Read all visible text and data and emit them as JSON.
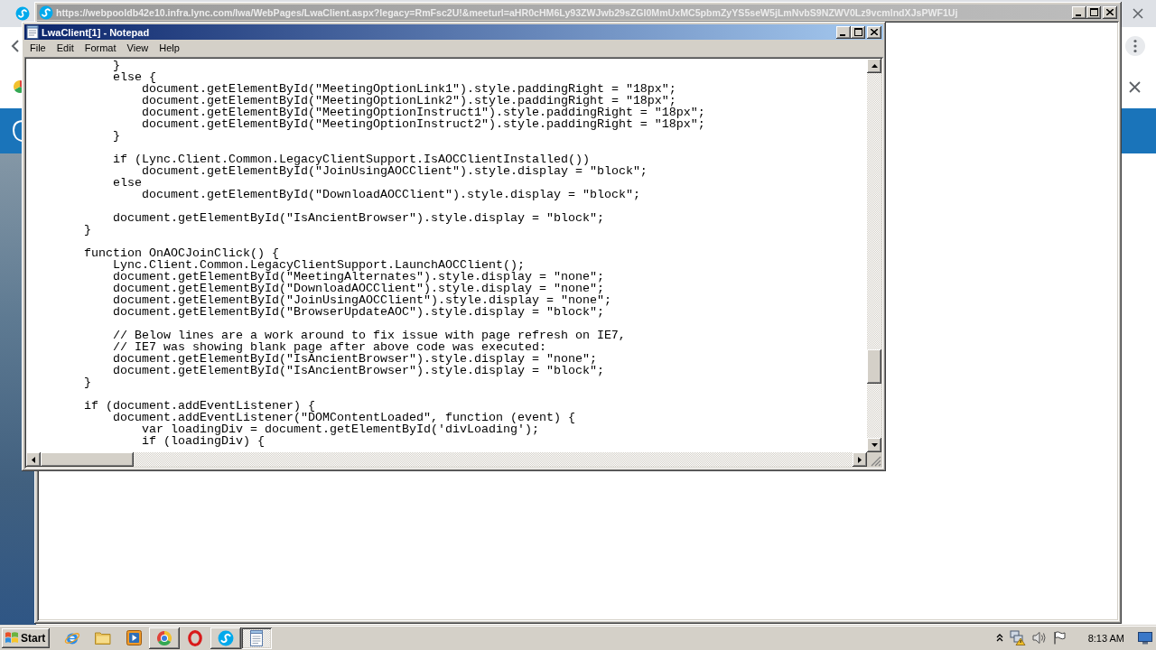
{
  "popup_window": {
    "active": false,
    "title": "https://webpooldb42e10.infra.lync.com/lwa/WebPages/LwaClient.aspx?legacy=RmFsc2U!&meeturl=aHR0cHM6Ly93ZWJwb29sZGI0MmUxMC5pbmZyYS5seW5jLmNvbS9NZWV0Lz9vcmlndXJsPWF1Uj"
  },
  "notepad": {
    "active": true,
    "title": "LwaClient[1] - Notepad",
    "menu": [
      {
        "label": "File"
      },
      {
        "label": "Edit"
      },
      {
        "label": "Format"
      },
      {
        "label": "View"
      },
      {
        "label": "Help"
      }
    ],
    "code": [
      {
        "children": [
          {
            "text": "}"
          },
          {
            "text": "else {",
            "children": [
              {
                "text": "document.getElementById(\"MeetingOptionLink1\").style.paddingRight = \"18px\";"
              },
              {
                "text": "document.getElementById(\"MeetingOptionLink2\").style.paddingRight = \"18px\";"
              },
              {
                "text": "document.getElementById(\"MeetingOptionInstruct1\").style.paddingRight = \"18px\";"
              },
              {
                "text": "document.getElementById(\"MeetingOptionInstruct2\").style.paddingRight = \"18px\";"
              }
            ]
          },
          {
            "text": "}",
            "blank_after": true
          },
          {
            "text": "if (Lync.Client.Common.LegacyClientSupport.IsAOCClientInstalled())",
            "children": [
              {
                "text": "document.getElementById(\"JoinUsingAOCClient\").style.display = \"block\";"
              }
            ]
          },
          {
            "text": "else",
            "children": [
              {
                "text": "document.getElementById(\"DownloadAOCClient\").style.display = \"block\";"
              }
            ],
            "blank_after": true
          },
          {
            "text": "document.getElementById(\"IsAncientBrowser\").style.display = \"block\";"
          }
        ]
      },
      {
        "text": "}",
        "blank_after": true
      },
      {
        "text": "function OnAOCJoinClick() {",
        "children": [
          {
            "text": "Lync.Client.Common.LegacyClientSupport.LaunchAOCClient();"
          },
          {
            "text": "document.getElementById(\"MeetingAlternates\").style.display = \"none\";"
          },
          {
            "text": "document.getElementById(\"DownloadAOCClient\").style.display = \"none\";"
          },
          {
            "text": "document.getElementById(\"JoinUsingAOCClient\").style.display = \"none\";"
          },
          {
            "text": "document.getElementById(\"BrowserUpdateAOC\").style.display = \"block\";",
            "blank_after": true
          },
          {
            "text": "// Below lines are a work around to fix issue with page refresh on IE7,"
          },
          {
            "text": "// IE7 was showing blank page after above code was executed:"
          },
          {
            "text": "document.getElementById(\"IsAncientBrowser\").style.display = \"none\";"
          },
          {
            "text": "document.getElementById(\"IsAncientBrowser\").style.display = \"block\";"
          }
        ]
      },
      {
        "text": "}",
        "blank_after": true
      },
      {
        "text": "if (document.addEventListener) {",
        "children": [
          {
            "text": "document.addEventListener(\"DOMContentLoaded\", function (event) {",
            "children": [
              {
                "text": "var loadingDiv = document.getElementById('divLoading');"
              },
              {
                "text": "if (loadingDiv) {"
              }
            ]
          }
        ]
      }
    ]
  },
  "taskbar": {
    "start": "Start",
    "items": [
      {
        "kind": "ie",
        "running": false,
        "selected": false
      },
      {
        "kind": "folder",
        "running": false,
        "selected": false
      },
      {
        "kind": "media",
        "running": false,
        "selected": false
      },
      {
        "kind": "chrome",
        "running": true,
        "selected": false
      },
      {
        "kind": "opera",
        "running": false,
        "selected": false
      },
      {
        "kind": "skype",
        "running": true,
        "selected": false
      },
      {
        "kind": "notepad",
        "running": true,
        "selected": true
      }
    ],
    "clock": "8:13 AM"
  }
}
